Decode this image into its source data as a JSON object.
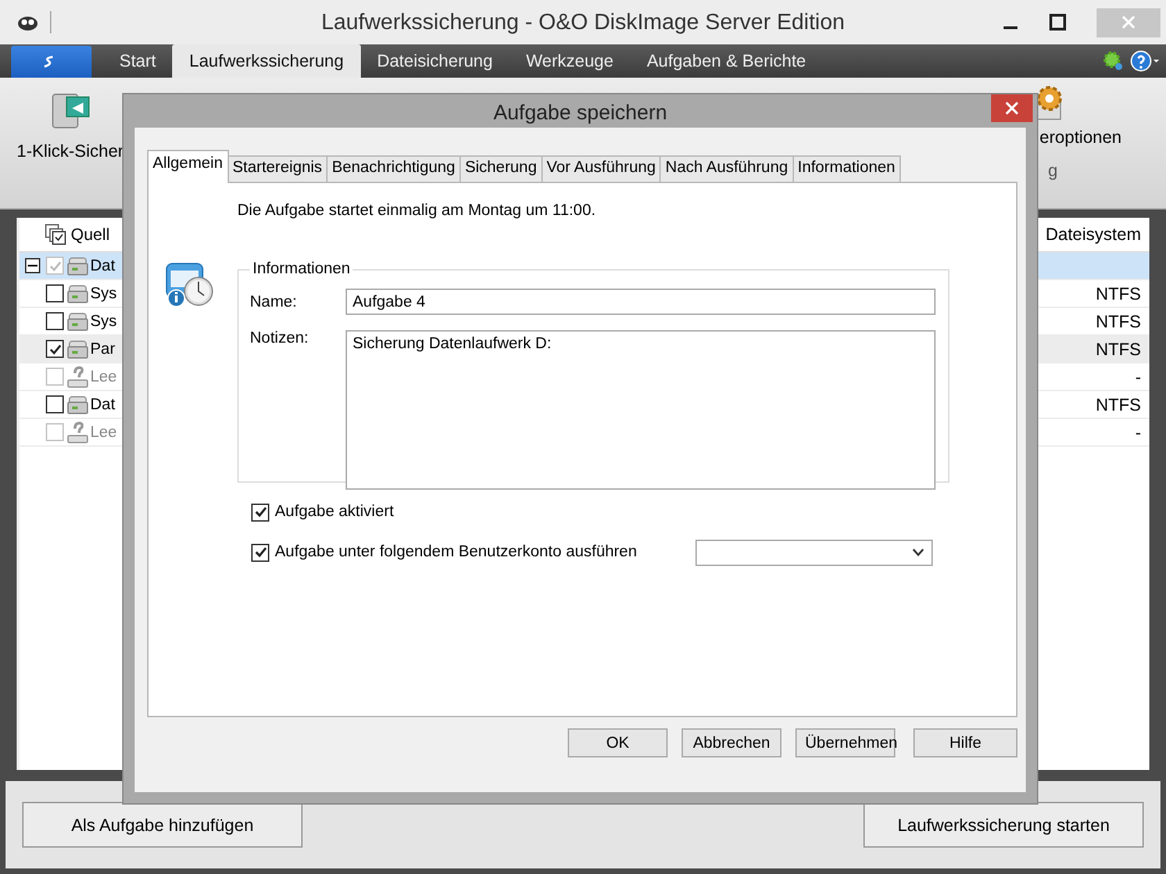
{
  "window": {
    "title": "Laufwerkssicherung - O&O DiskImage Server Edition"
  },
  "ribbon_tabs": [
    {
      "label": "Start",
      "selected": false
    },
    {
      "label": "Laufwerkssicherung",
      "selected": true
    },
    {
      "label": "Dateisicherung",
      "selected": false
    },
    {
      "label": "Werkzeuge",
      "selected": false
    },
    {
      "label": "Aufgaben & Berichte",
      "selected": false
    }
  ],
  "ribbon": {
    "left_label": "1-Klick-Sicher",
    "right_label": "eroptionen",
    "right_group": "g"
  },
  "source_list": {
    "header": "Quell",
    "right_header": "Dateisystem",
    "rows": [
      {
        "name": "Dat",
        "kind": "drive",
        "checked": true,
        "disabled": true,
        "selected": true,
        "hovered": false,
        "expanded": true,
        "children": [
          {
            "name": "Sys",
            "kind": "drive",
            "filesystem": "NTFS",
            "checked": false,
            "disabled": false,
            "selected": false,
            "hovered": false
          },
          {
            "name": "Sys",
            "kind": "drive",
            "filesystem": "NTFS",
            "checked": false,
            "disabled": false,
            "selected": false,
            "hovered": false
          },
          {
            "name": "Par",
            "kind": "drive",
            "filesystem": "NTFS",
            "checked": true,
            "disabled": false,
            "selected": false,
            "hovered": true
          },
          {
            "name": "Lee",
            "kind": "unknown",
            "filesystem": "-",
            "checked": false,
            "disabled": true,
            "selected": false,
            "hovered": false
          },
          {
            "name": "Dat",
            "kind": "drive",
            "filesystem": "NTFS",
            "checked": false,
            "disabled": false,
            "selected": false,
            "hovered": false
          },
          {
            "name": "Lee",
            "kind": "unknown",
            "filesystem": "-",
            "checked": false,
            "disabled": true,
            "selected": false,
            "hovered": false
          }
        ]
      }
    ]
  },
  "bottom_buttons": [
    "Als Aufgabe hinzufügen",
    "Laufwerkssicherung starten"
  ],
  "dialog": {
    "title": "Aufgabe speichern",
    "tabs": [
      {
        "label": "Allgemein",
        "selected": true
      },
      {
        "label": "Startereignis",
        "selected": false
      },
      {
        "label": "Benachrichtigung",
        "selected": false
      },
      {
        "label": "Sicherung",
        "selected": false
      },
      {
        "label": "Vor Ausführung",
        "selected": false
      },
      {
        "label": "Nach Ausführung",
        "selected": false
      },
      {
        "label": "Informationen",
        "selected": false
      }
    ],
    "schedule_text": "Die Aufgabe startet einmalig am Montag um 11:00.",
    "group_title": "Informationen",
    "name_label": "Name:",
    "name_value": "Aufgabe 4",
    "notes_label": "Notizen:",
    "notes_value": "Sicherung Datenlaufwerk D:",
    "checkboxes": [
      {
        "label": "Aufgabe aktiviert",
        "checked": true,
        "kind": "plain"
      },
      {
        "label": "Aufgabe unter folgendem Benutzerkonto ausführen",
        "checked": true,
        "kind": "account"
      }
    ],
    "buttons": [
      "OK",
      "Abbrechen",
      "Übernehmen",
      "Hilfe"
    ]
  }
}
